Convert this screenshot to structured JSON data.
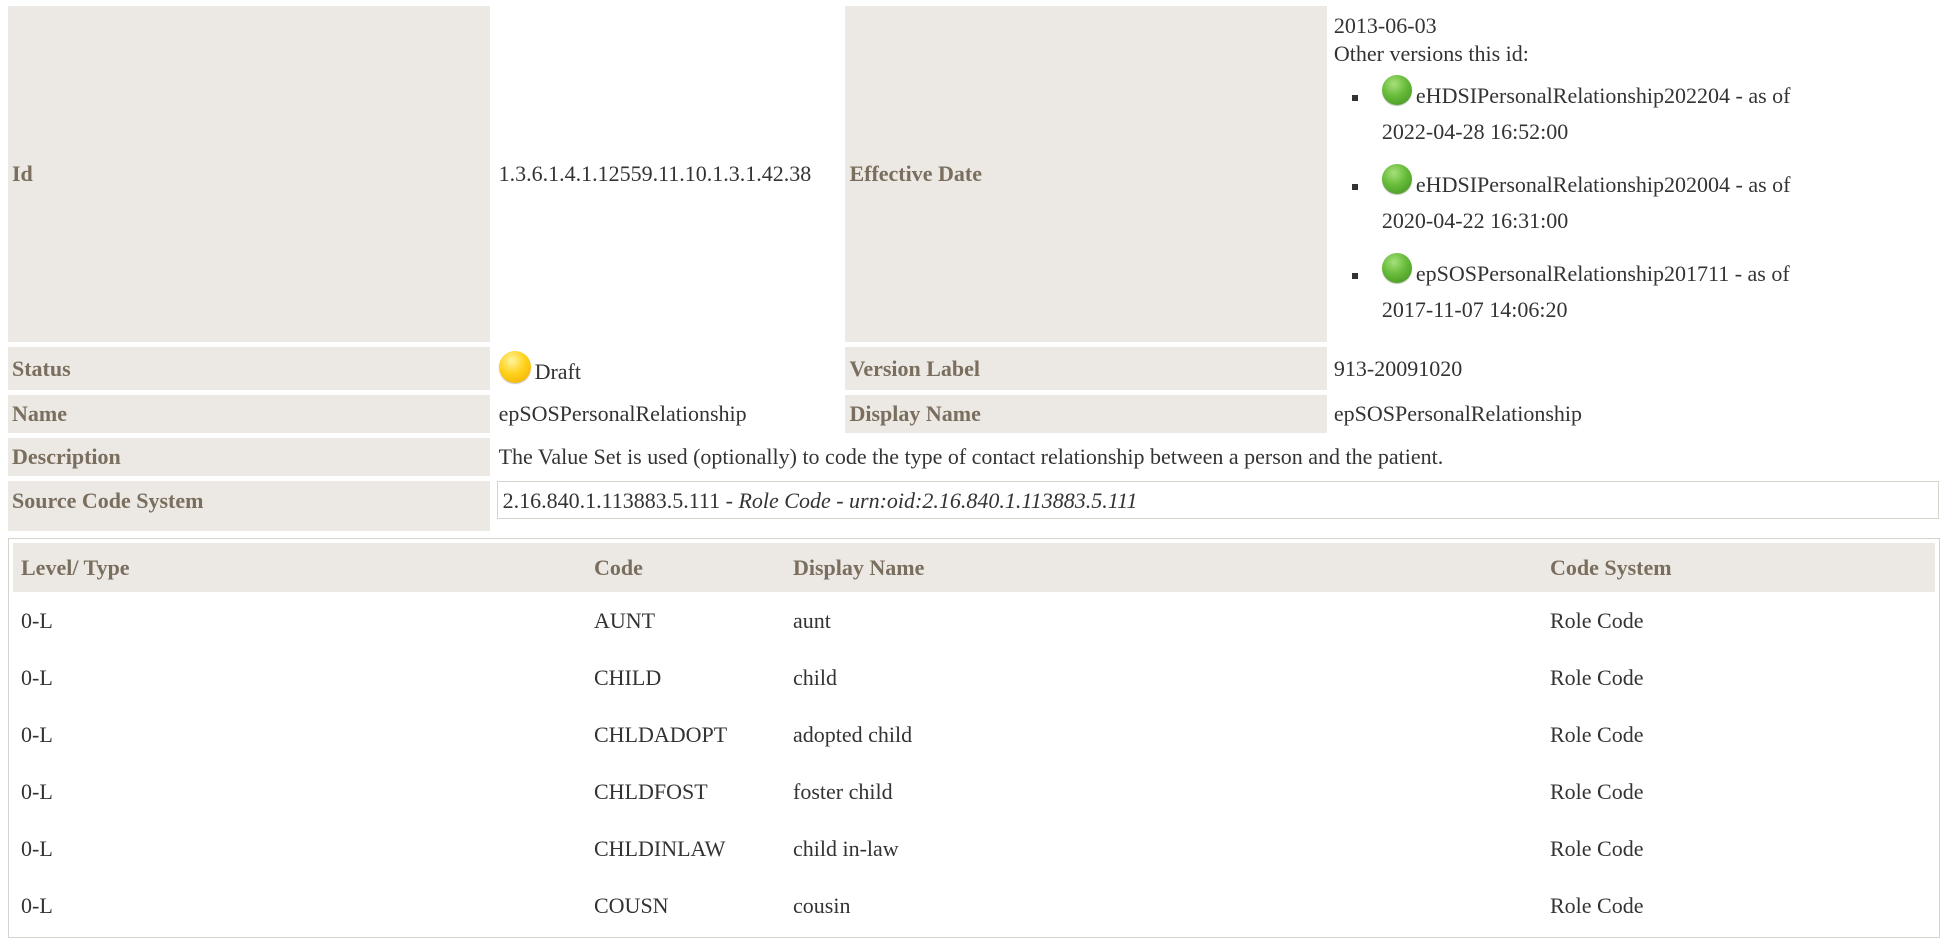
{
  "meta": {
    "id_label": "Id",
    "id_value": "1.3.6.1.4.1.12559.11.10.1.3.1.42.38",
    "effective_date_label": "Effective Date",
    "effective_date_value": "2013-06-03",
    "other_versions_label": "Other versions this id:",
    "other_versions": [
      {
        "name": "eHDSIPersonalRelationship202204",
        "sep": " - as of ",
        "date": "2022-04-28 16:52:00",
        "status": "green"
      },
      {
        "name": "eHDSIPersonalRelationship202004",
        "sep": " - as of ",
        "date": "2020-04-22 16:31:00",
        "status": "green"
      },
      {
        "name": "epSOSPersonalRelationship201711",
        "sep": " - as of ",
        "date": "2017-11-07 14:06:20",
        "status": "green"
      }
    ],
    "status_label": "Status",
    "status_value": "Draft",
    "version_label_label": "Version Label",
    "version_label_value": "913-20091020",
    "name_label": "Name",
    "name_value": "epSOSPersonalRelationship",
    "display_name_label": "Display Name",
    "display_name_value": "epSOSPersonalRelationship",
    "description_label": "Description",
    "description_value": "The Value Set is used (optionally) to code the type of contact relationship between a person and the patient.",
    "source_code_system_label": "Source Code System",
    "source_oid": "2.16.840.1.113883.5.111",
    "source_sep1": " - ",
    "source_name": "Role Code",
    "source_sep2": " - ",
    "source_urn": "urn:oid:2.16.840.1.113883.5.111"
  },
  "codes": {
    "headers": [
      "Level/ Type",
      "Code",
      "Display Name",
      "Code System"
    ],
    "rows": [
      [
        "0-L",
        "AUNT",
        "aunt",
        "Role Code"
      ],
      [
        "0-L",
        "CHILD",
        "child",
        "Role Code"
      ],
      [
        "0-L",
        "CHLDADOPT",
        "adopted child",
        "Role Code"
      ],
      [
        "0-L",
        "CHLDFOST",
        "foster child",
        "Role Code"
      ],
      [
        "0-L",
        "CHLDINLAW",
        "child in-law",
        "Role Code"
      ],
      [
        "0-L",
        "COUSN",
        "cousin",
        "Role Code"
      ]
    ]
  },
  "colors": {
    "label_bg": "#ece9e4",
    "label_text": "#7a6e5e",
    "status_draft": "#ffd21c",
    "status_active": "#67bb3a"
  }
}
